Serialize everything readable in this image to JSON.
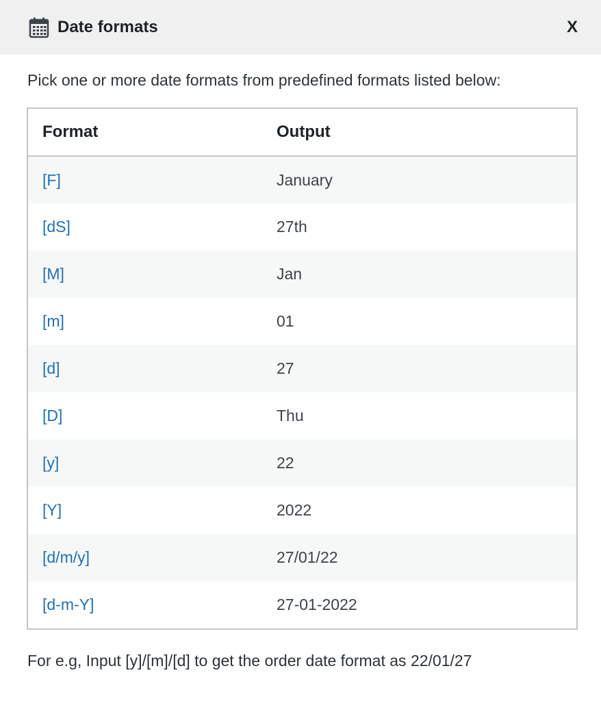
{
  "dialog": {
    "title": "Date formats",
    "icon": "calendar-icon",
    "close_label": "X"
  },
  "intro_text": "Pick one or more date formats from predefined formats listed below:",
  "table": {
    "headers": [
      "Format",
      "Output"
    ],
    "rows": [
      {
        "format": "[F]",
        "output": "January"
      },
      {
        "format": "[dS]",
        "output": "27th"
      },
      {
        "format": "[M]",
        "output": "Jan"
      },
      {
        "format": "[m]",
        "output": "01"
      },
      {
        "format": "[d]",
        "output": "27"
      },
      {
        "format": "[D]",
        "output": "Thu"
      },
      {
        "format": "[y]",
        "output": "22"
      },
      {
        "format": "[Y]",
        "output": "2022"
      },
      {
        "format": "[d/m/y]",
        "output": "27/01/22"
      },
      {
        "format": "[d-m-Y]",
        "output": "27-01-2022"
      }
    ]
  },
  "footer_note": "For e.g, Input [y]/[m]/[d] to get the order date format as 22/01/27",
  "colors": {
    "link": "#2271b1",
    "header_bg": "#f0f0f1",
    "stripe": "#f6f7f7",
    "border": "#c3c4c7"
  }
}
